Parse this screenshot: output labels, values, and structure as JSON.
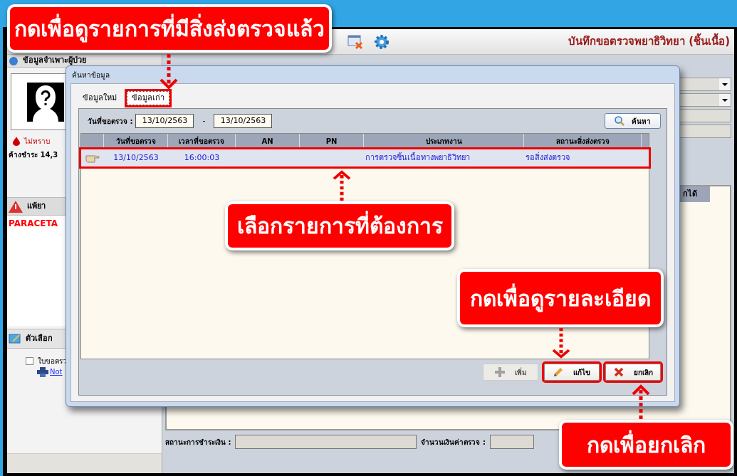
{
  "app": {
    "title": "บันทึกขอตรวจพยาธิวิทยา (ชิ้นเนื้อ)",
    "patient_panel": {
      "header": "ข้อมูลจำเพาะผู้ป่วย",
      "blood_type": "ไม่ทราบ",
      "outstanding": "ค้างชำระ 14,3"
    },
    "allergy_panel": {
      "header": "แพ้ยา",
      "items": [
        "PARACETA"
      ]
    },
    "options_panel": {
      "header": "ตัวเลือก",
      "checkbox": {
        "label": "ใบขอตรว",
        "checked": false
      },
      "print_link": "Not"
    },
    "grid_header": "กได้",
    "footer": {
      "payment_status_label": "สถานะการชำระเงิน :",
      "exam_fee_label": "จำนวนเงินค่าตรวจ :"
    }
  },
  "dialog": {
    "title": "ค้นหาข้อมูล",
    "tabs": [
      {
        "label": "ข้อมูลใหม่",
        "selected": false,
        "highlighted": false
      },
      {
        "label": "ข้อมูลเก่า",
        "selected": true,
        "highlighted": true
      }
    ],
    "date_label": "วันที่ขอตรวจ :",
    "date_from": "13/10/2563",
    "date_separator": "-",
    "date_to": "13/10/2563",
    "search_button": "ค้นหา",
    "table": {
      "columns": [
        "วันที่ขอตรวจ",
        "เวลาที่ขอตรวจ",
        "AN",
        "PN",
        "ประเภทงาน",
        "สถานะสิ่งส่งตรวจ"
      ],
      "rows": [
        {
          "cells": [
            "13/10/2563",
            "16:00:03",
            "",
            "",
            "การตรวจชิ้นเนื้อทางพยาธิวิทยา",
            "รอสิ่งส่งตรวจ"
          ],
          "selected": true,
          "highlighted": true
        }
      ]
    },
    "buttons": [
      {
        "label": "เพิ่ม",
        "kind": "add",
        "disabled": true,
        "highlighted": false
      },
      {
        "label": "แก้ไข",
        "kind": "edit",
        "disabled": false,
        "highlighted": true
      },
      {
        "label": "ยกเลิก",
        "kind": "cancel",
        "disabled": false,
        "highlighted": true
      }
    ]
  },
  "callouts": [
    {
      "text": "กดเพื่อดูรายการที่มีสิ่งส่งตรวจแล้ว"
    },
    {
      "text": "เลือกรายการที่ต้องการ"
    },
    {
      "text": "กดเพื่อดูรายละเอียด"
    },
    {
      "text": "กดเพื่อยกเลิก"
    }
  ]
}
